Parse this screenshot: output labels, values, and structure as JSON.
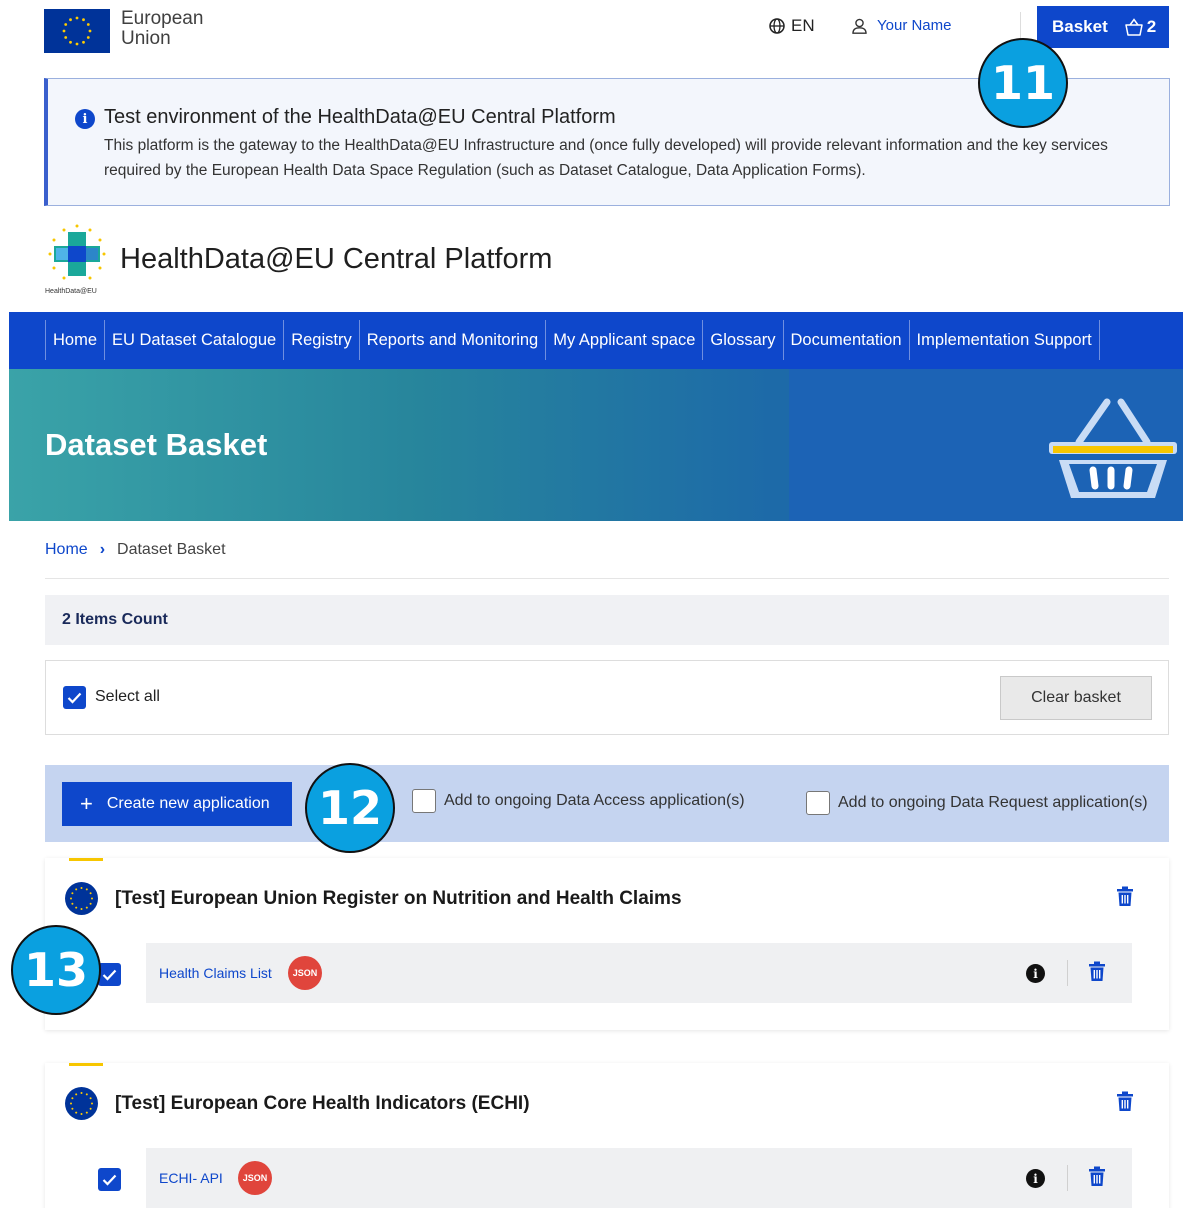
{
  "topbar": {
    "eu_name_line1": "European",
    "eu_name_line2": "Union",
    "language": "EN",
    "user_name": "Your Name",
    "basket_label": "Basket",
    "basket_count": "2"
  },
  "annotations": [
    "11",
    "12",
    "13"
  ],
  "banner": {
    "title": "Test environment of the HealthData@EU Central Platform",
    "text": "This platform is the gateway to the HealthData@EU Infrastructure and (once fully developed) will provide relevant information and the key services required by the European Health Data Space Regulation (such as Dataset Catalogue, Data Application Forms)."
  },
  "platform": {
    "title": "HealthData@EU Central Platform",
    "logo_text": "HealthData@EU"
  },
  "nav": {
    "items": [
      {
        "label": "Home"
      },
      {
        "label": "EU Dataset Catalogue"
      },
      {
        "label": "Registry"
      },
      {
        "label": "Reports and Monitoring"
      },
      {
        "label": "My Applicant space"
      },
      {
        "label": "Glossary"
      },
      {
        "label": "Documentation"
      },
      {
        "label": "Implementation Support"
      }
    ]
  },
  "hero": {
    "title": "Dataset Basket"
  },
  "breadcrumb": {
    "home": "Home",
    "current": "Dataset Basket"
  },
  "basket": {
    "items_count": "2 Items Count",
    "select_all": "Select all",
    "clear": "Clear basket",
    "create": "Create new application",
    "add_access": "Add to ongoing Data Access application(s)",
    "add_request": "Add to ongoing Data Request application(s)"
  },
  "datasets": [
    {
      "title": "[Test] European Union Register on Nutrition and Health Claims",
      "resource": "Health Claims List",
      "format": "JSON",
      "checked": true
    },
    {
      "title": "[Test] European Core Health Indicators (ECHI)",
      "resource": "ECHI- API",
      "format": "JSON",
      "checked": true
    }
  ],
  "colors": {
    "primary": "#0e47cb",
    "eu_blue": "#003399",
    "accent_yellow": "#f7c600",
    "json_badge": "#e0453c",
    "annotation": "#0aa0e0"
  }
}
